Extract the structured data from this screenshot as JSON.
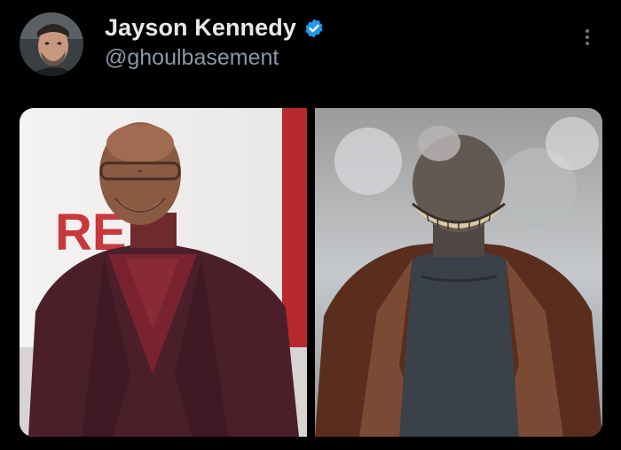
{
  "post": {
    "author": {
      "display_name": "Jayson Kennedy",
      "handle": "@ghoulbasement",
      "verified": true,
      "avatar_icon": "avatar-photo"
    },
    "menu_icon": "more-options-icon",
    "media": [
      {
        "icon": "photo-smiling-man-burgundy-coat",
        "background_text": "RE"
      },
      {
        "icon": "photo-creature-brown-coat"
      }
    ]
  },
  "colors": {
    "background": "#000000",
    "text_primary": "#e7e9ea",
    "text_secondary": "#8b98a5",
    "verified_badge": "#1d9bf0"
  }
}
